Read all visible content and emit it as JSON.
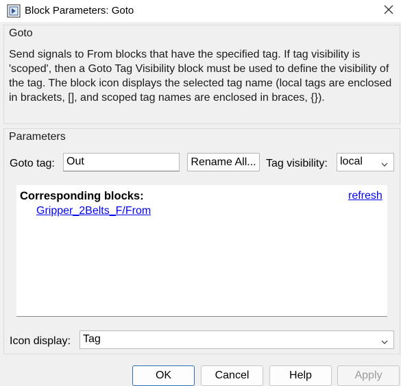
{
  "window": {
    "title": "Block Parameters: Goto",
    "app_icon": "simulink-block-icon",
    "close_icon": "close-icon"
  },
  "goto_section": {
    "legend": "Goto",
    "description": "Send signals to From blocks that have the specified tag.  If tag visibility is 'scoped', then a Goto Tag Visibility block must be used to define the visibility of the tag.  The block icon displays the selected tag name (local tags are enclosed in brackets, [], and scoped tag names are enclosed in braces, {})."
  },
  "parameters": {
    "legend": "Parameters",
    "goto_tag_label": "Goto tag:",
    "goto_tag_value": "Out",
    "rename_all_label": "Rename All...",
    "tag_visibility_label": "Tag visibility:",
    "tag_visibility_value": "local",
    "corresponding_blocks_heading": "Corresponding blocks:",
    "refresh_link": "refresh",
    "blocks": [
      "Gripper_2Belts_F/From"
    ],
    "icon_display_label": "Icon display:",
    "icon_display_value": "Tag"
  },
  "footer": {
    "ok": "OK",
    "cancel": "Cancel",
    "help": "Help",
    "apply": "Apply"
  }
}
